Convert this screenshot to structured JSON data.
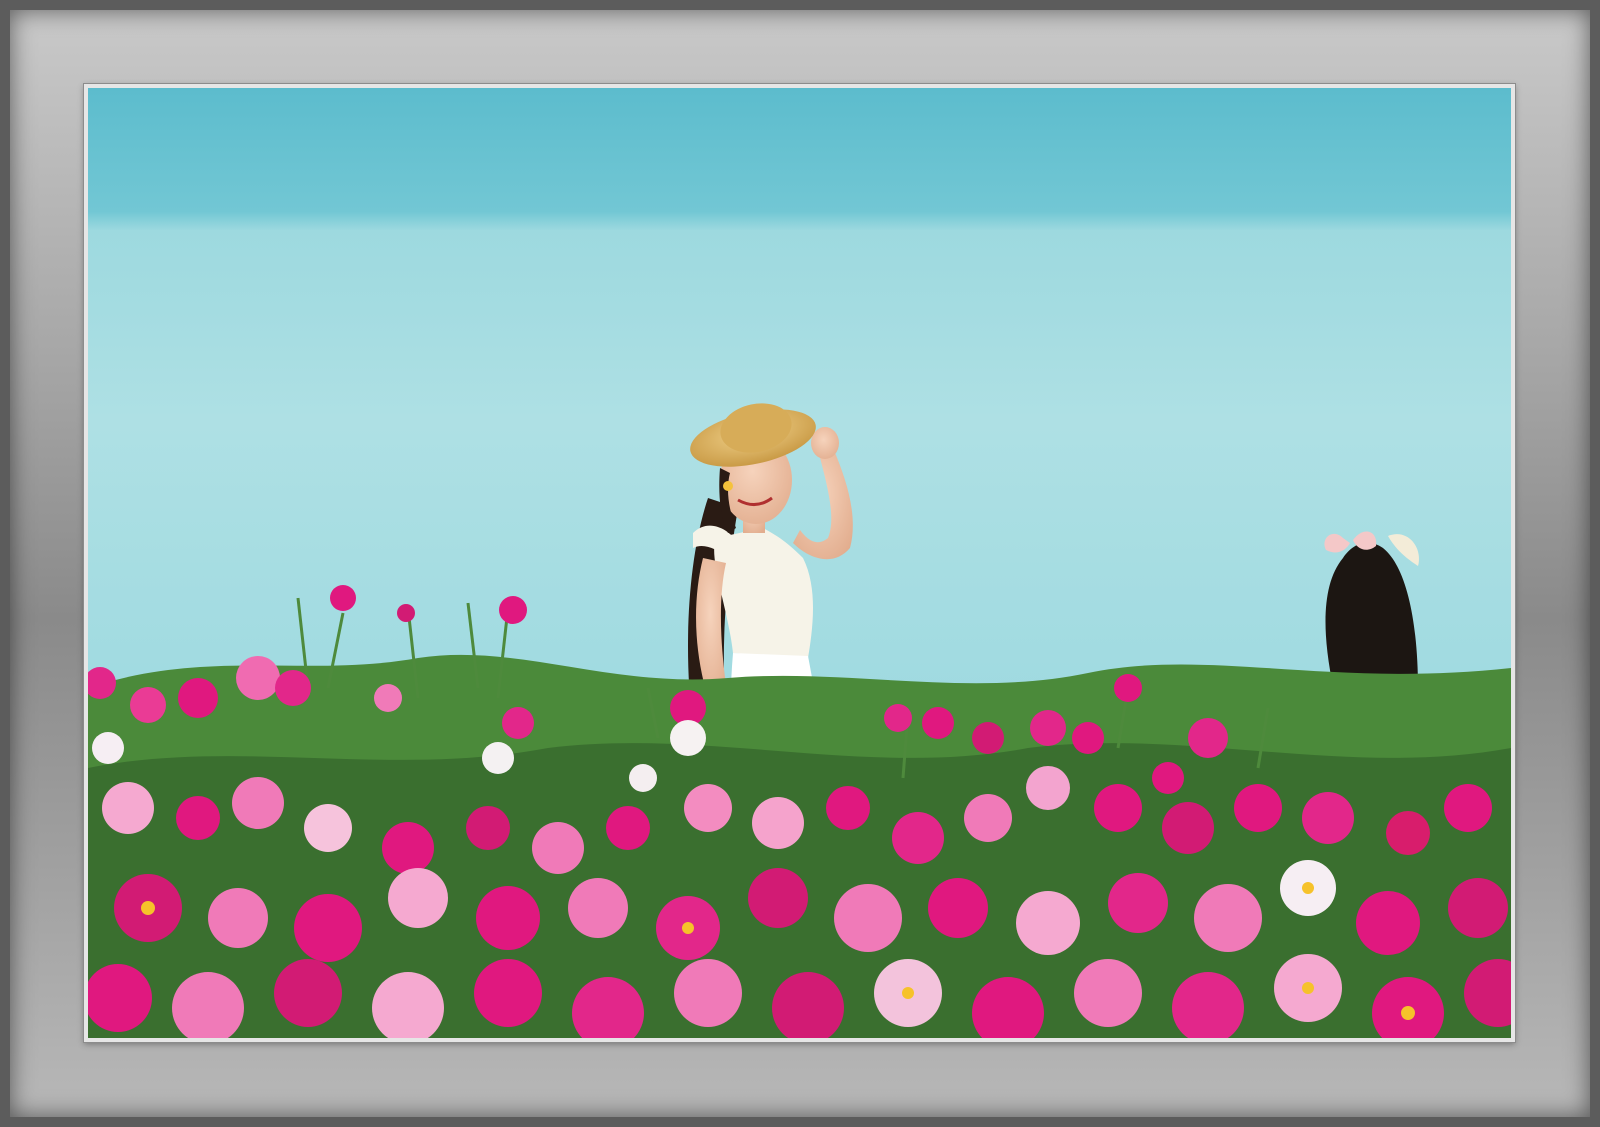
{
  "scene": {
    "subject": "woman-in-straw-hat-among-peonies",
    "colors": {
      "frame_outer": "#5c5c5c",
      "mat": "#e6e6e6",
      "water_top": "#5fbfcf",
      "water_bottom": "#8ed3dc",
      "flower_magenta": "#e0187f",
      "flower_pink": "#f07ab8",
      "flower_light": "#f7c9e2",
      "foliage": "#3f7a34"
    }
  }
}
